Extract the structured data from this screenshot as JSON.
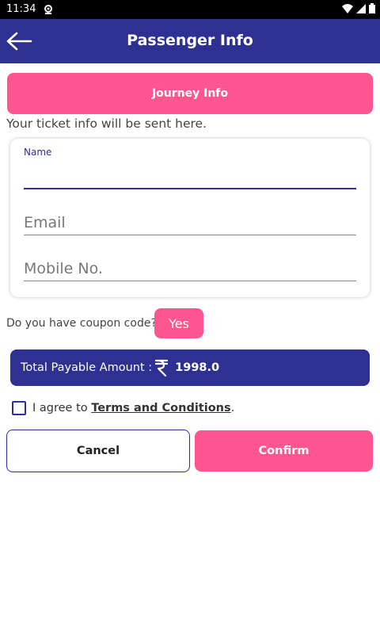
{
  "status": {
    "time": "11:34"
  },
  "header": {
    "title": "Passenger Info"
  },
  "journey": {
    "label": "Journey Info"
  },
  "helper": {
    "text": "Your ticket info will be sent here."
  },
  "form": {
    "name_label": "Name",
    "name_value": "",
    "email_placeholder": "Email",
    "mobile_placeholder": "Mobile No."
  },
  "coupon": {
    "question": "Do you have coupon code?",
    "button": "Yes"
  },
  "total": {
    "label": "Total Payable Amount :",
    "currency_icon": "rupee-icon",
    "amount": "1998.0"
  },
  "agree": {
    "prefix": "I agree to ",
    "link": "Terms and Conditions",
    "suffix": "."
  },
  "actions": {
    "cancel": "Cancel",
    "confirm": "Confirm"
  },
  "colors": {
    "primary": "#2e3192",
    "accent": "#ff5590"
  }
}
